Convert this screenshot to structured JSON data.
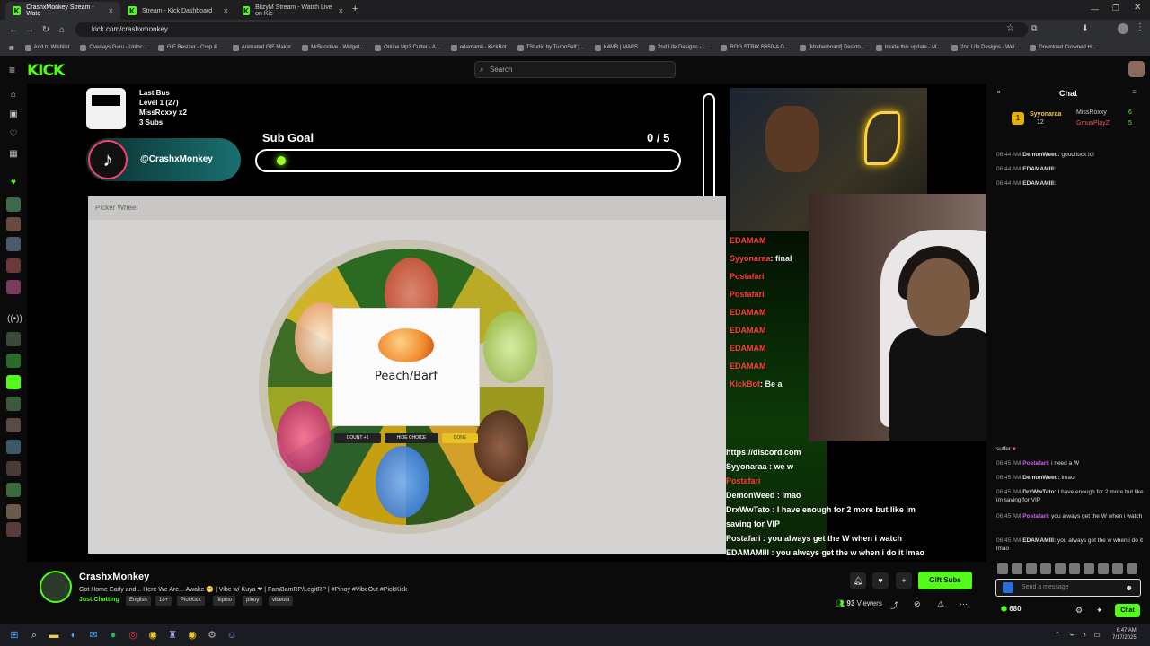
{
  "browser": {
    "tabs": [
      {
        "title": "CrashxMonkey Stream - Watc"
      },
      {
        "title": "Stream - Kick Dashboard"
      },
      {
        "title": "BlizyM Stream - Watch Live on Kic"
      }
    ],
    "url": "kick.com/crashxmonkey",
    "bookmarks": [
      "Add to Wishlist",
      "Overlays.Guru - Unloc...",
      "GIF Resizer - Crop &...",
      "Animated GIF Maker",
      "MrBoostive - Widget...",
      "Online Mp3 Cutter - A...",
      "edamamii - KickBot",
      "TStudio by TurboSelf |...",
      "K4MB | MAPS",
      "2nd Life Designs - L...",
      "ROG STRIX B650-A G...",
      "[Motherboard] Deskto...",
      "Inside this update - M...",
      "2nd Life Designs - Wel...",
      "Download Crowned H..."
    ]
  },
  "header": {
    "logo": "KICK",
    "search_placeholder": "Search"
  },
  "overlay": {
    "last_bus_title": "Last Bus",
    "last_bus_level": "Level 1 (27)",
    "last_bus_user": "MissRoxxy x2",
    "last_bus_subs": "3 Subs",
    "tiktok_handle": "@CrashxMonkey",
    "sub_goal_label": "Sub Goal",
    "sub_goal_count": "0 / 5",
    "picker_title": "Picker Wheel",
    "result_label": "Peach/Barf",
    "btn_count": "COUNT +1",
    "btn_hide": "HIDE CHOICE",
    "btn_done": "DONE"
  },
  "stream_chat": [
    {
      "user": "EDAMAM",
      "text": "",
      "color": "#ff3a3a"
    },
    {
      "user": "Syyonaraa",
      "text": ": final",
      "color": "#ff3a3a"
    },
    {
      "user": "Postafari",
      "text": "",
      "color": "#ff3a3a"
    },
    {
      "user": "Postafari",
      "text": "",
      "color": "#ff3a3a"
    },
    {
      "user": "EDAMAM",
      "text": "",
      "color": "#ff3a3a"
    },
    {
      "user": "EDAMAM",
      "text": "",
      "color": "#ff3a3a"
    },
    {
      "user": "EDAMAM",
      "text": "",
      "color": "#ff3a3a"
    },
    {
      "user": "EDAMAM",
      "text": "",
      "color": "#ff3a3a"
    },
    {
      "user": "KickBot",
      "text": ": Be a",
      "color": "#ff3a3a"
    }
  ],
  "stream_chat_lower": [
    {
      "text": "https://discord.com"
    },
    {
      "text": "Syyonaraa : we w"
    },
    {
      "text": "Postafari"
    },
    {
      "text": "DemonWeed : lmao"
    },
    {
      "text": "DrxWwTato : I have enough for 2 more but like im saving for VIP"
    },
    {
      "text": "Postafari : you always get the W when i watch"
    },
    {
      "text": "EDAMAMIII : you always get the w when i do it lmao"
    }
  ],
  "chat": {
    "title": "Chat",
    "top_gifter": "Syyonaraa",
    "top_gifter_count": "12",
    "gifter2": "MissRoxxy",
    "gifter2_count": "6",
    "gifter3": "GmunPlayZ",
    "gifter3_count": "5",
    "messages": [
      {
        "time": "06:44 AM",
        "user": "DemonWeed:",
        "text": "good luck lol",
        "color": "#ffffff"
      },
      {
        "time": "06:44 AM",
        "user": "EDAMAMIII:",
        "text": "",
        "color": "#ffffff"
      },
      {
        "time": "06:44 AM",
        "user": "EDAMAMIII:",
        "text": "",
        "color": "#ffffff"
      }
    ],
    "messages_lower": [
      {
        "time": "",
        "user": "",
        "text": "suffer",
        "color": "#ffffff"
      },
      {
        "time": "06:45 AM",
        "user": "Postafari:",
        "text": "i need a W",
        "color": "#d95cff"
      },
      {
        "time": "06:45 AM",
        "user": "DemonWeed:",
        "text": "lmao",
        "color": "#ffffff"
      },
      {
        "time": "06:45 AM",
        "user": "DrxWwTato:",
        "text": "I have enough for 2 more but like im saving for VIP",
        "color": "#ffffff"
      },
      {
        "time": "06:45 AM",
        "user": "Postafari:",
        "text": "you always get the W when i watch",
        "color": "#d95cff"
      },
      {
        "time": "06:45 AM",
        "user": "EDAMAMIII:",
        "text": "you always get the w when i do it lmao",
        "color": "#ffffff"
      }
    ],
    "input_placeholder": "Send a message",
    "points": "680",
    "send_label": "Chat"
  },
  "stream_info": {
    "name": "CrashxMonkey",
    "title": "Got Home Early and... Here We Are... Awake 😁 | Vibe w/ Kuya ❤ | FamBamRP/LegitRP | #Pinoy #VibeOut #PickKick",
    "category": "Just Chatting",
    "tags": [
      "English",
      "18+",
      "PickKick",
      "filipino",
      "pinoy",
      "vibeout"
    ],
    "viewers": "93",
    "viewers_label": "Viewers",
    "gift_subs": "Gift Subs"
  },
  "taskbar": {
    "time": "6:47 AM",
    "date": "7/17/2025"
  },
  "colors": {
    "kick_green": "#53fc18",
    "bg": "#0b0b0c"
  }
}
